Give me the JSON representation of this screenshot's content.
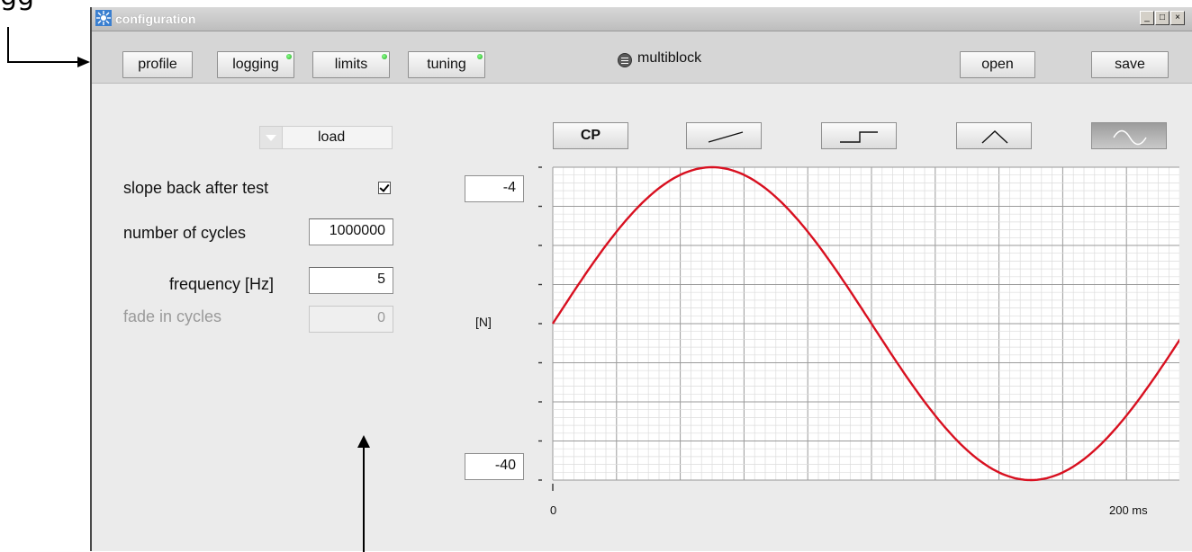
{
  "window": {
    "title": "configuration"
  },
  "callout": {
    "text": "gg"
  },
  "toolbar": {
    "buttons": [
      {
        "label": "profile",
        "led": false
      },
      {
        "label": "logging",
        "led": true
      },
      {
        "label": "limits",
        "led": true
      },
      {
        "label": "tuning",
        "led": true
      }
    ],
    "multiblock_label": "multiblock",
    "open_label": "open",
    "save_label": "save"
  },
  "form": {
    "mode_select": "load",
    "slope_back_label": "slope back after test",
    "slope_back_checked": true,
    "cycles_label": "number of cycles",
    "cycles_value": "1000000",
    "frequency_label": "frequency [Hz]",
    "frequency_value": "5",
    "fade_label": "fade in cycles",
    "fade_value": "0"
  },
  "profile_buttons": {
    "cp_label": "CP",
    "shapes": [
      "ramp-icon",
      "step-icon",
      "triangle-icon",
      "sine-icon"
    ],
    "active": "sine-icon"
  },
  "chart": {
    "y_max_value": "-4",
    "y_min_value": "-40",
    "y_unit": "[N]",
    "x_start_label": "0",
    "x_end_label": "200 ms",
    "line_color": "#d81020"
  },
  "chart_data": {
    "type": "line",
    "title": "",
    "xlabel": "",
    "ylabel": "[N]",
    "xlim": [
      0,
      200
    ],
    "ylim": [
      -40,
      -4
    ],
    "x_unit": "ms",
    "grid": true,
    "series": [
      {
        "x": [
          0,
          10,
          20,
          30,
          40,
          50,
          60,
          70,
          80,
          90,
          100,
          110,
          120,
          130,
          140,
          150,
          160,
          170,
          180,
          190,
          200
        ],
        "values": [
          -22,
          -16.4,
          -11.4,
          -7.4,
          -4.9,
          -4,
          -4.9,
          -7.4,
          -11.4,
          -16.4,
          -22,
          -27.6,
          -32.6,
          -36.6,
          -39.1,
          -40,
          -39.1,
          -36.6,
          -32.6,
          -27.6,
          -22
        ]
      }
    ]
  }
}
